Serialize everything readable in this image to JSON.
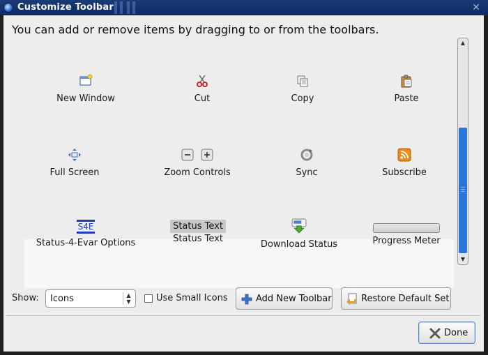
{
  "window": {
    "title": "Customize Toolbar",
    "close_glyph": "✕"
  },
  "heading": "You can add or remove items by dragging to or from the toolbars.",
  "items": [
    {
      "label": "New Window",
      "icon": "new-window-icon"
    },
    {
      "label": "Cut",
      "icon": "scissors-icon"
    },
    {
      "label": "Copy",
      "icon": "copy-icon"
    },
    {
      "label": "Paste",
      "icon": "paste-icon"
    },
    {
      "label": "Full Screen",
      "icon": "fullscreen-icon"
    },
    {
      "label": "Zoom Controls",
      "icon": "zoom-controls-icon"
    },
    {
      "label": "Sync",
      "icon": "sync-icon"
    },
    {
      "label": "Subscribe",
      "icon": "rss-icon"
    }
  ],
  "status_items": {
    "s4e_badge": "S4E",
    "s4e_label": "Status-4-Evar Options",
    "status_text_chip": "Status Text",
    "status_text_label": "Status Text",
    "download_label": "Download Status",
    "progress_label": "Progress Meter"
  },
  "controls": {
    "show_label": "Show:",
    "show_value": "Icons",
    "small_icons_label": "Use Small Icons",
    "small_icons_checked": false,
    "add_toolbar": "Add New Toolbar",
    "restore_default": "Restore Default Set",
    "done": "Done"
  },
  "colors": {
    "titlebar": "#1a3b78",
    "accent": "#2a73d8",
    "background": "#ededed"
  }
}
